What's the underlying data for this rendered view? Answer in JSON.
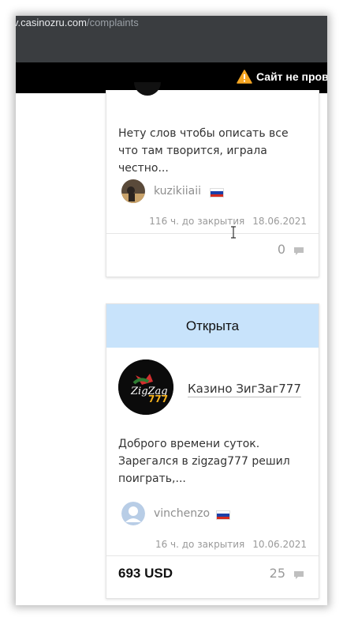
{
  "browser": {
    "url_domain": "v.casinozru.com",
    "url_path": "/complaints"
  },
  "warning": {
    "text": "Сайт не прове",
    "icon": "warning-icon",
    "color": "#f5a623"
  },
  "cards": [
    {
      "excerpt": "Нету слов чтобы описать все что там творится, играла честно...",
      "user": "kuzikiiaii",
      "flag": "russia-flag",
      "time_left": "116 ч. до закрытия",
      "date": "18.06.2021",
      "comments": "0"
    },
    {
      "status": "Открыта",
      "status_color": "#c8e3fb",
      "casino": "Казино ЗигЗаг777",
      "excerpt": "Доброго времени суток. Зарегался в zigzag777 решил поиграть,...",
      "user": "vinchenzo",
      "flag": "russia-flag",
      "time_left": "16 ч. до закрытия",
      "date": "10.06.2021",
      "amount": "693 USD",
      "comments": "25"
    }
  ]
}
